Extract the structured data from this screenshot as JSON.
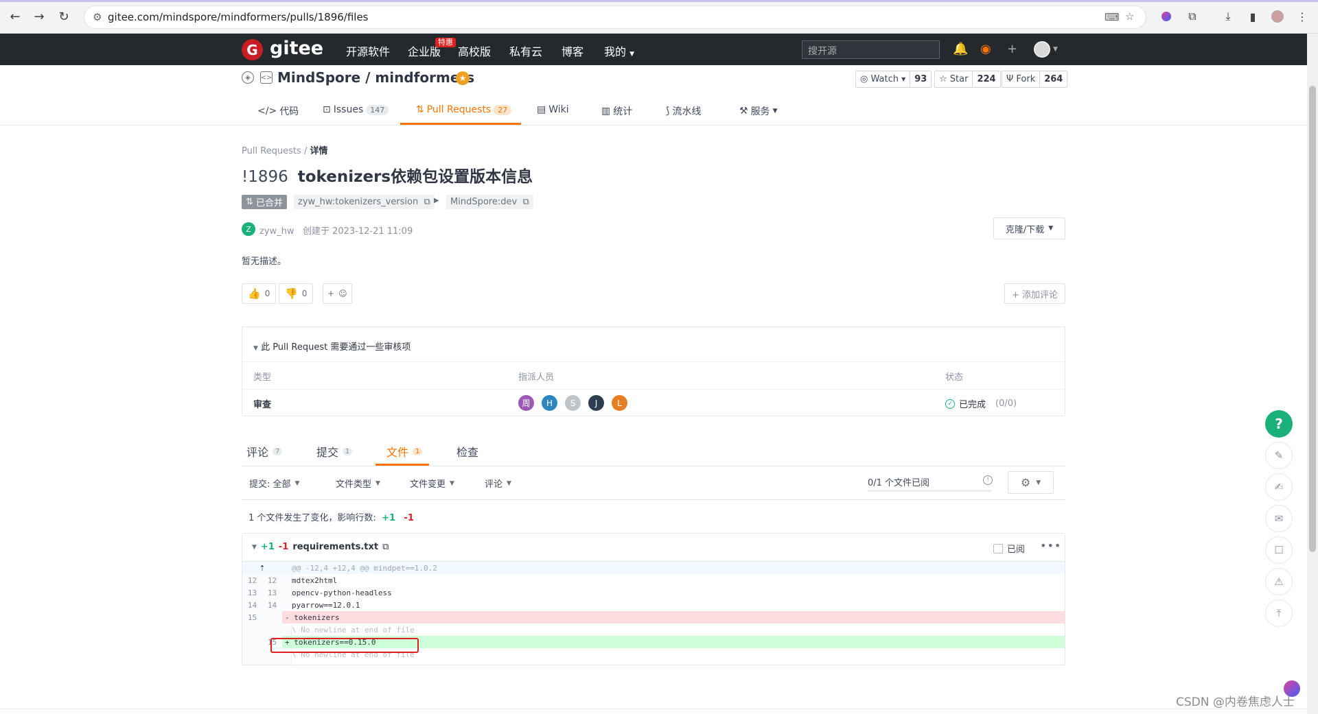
{
  "browser": {
    "url": "gitee.com/mindspore/mindformers/pulls/1896/files"
  },
  "gitee": {
    "logo": "gitee",
    "nav": [
      "开源软件",
      "企业版",
      "高校版",
      "私有云",
      "博客",
      "我的"
    ],
    "special_badge": "特惠",
    "search_placeholder": "搜开源"
  },
  "repo": {
    "title": "MindSpore / mindformers",
    "watch_label": "Watch",
    "watch_count": "93",
    "star_label": "Star",
    "star_count": "224",
    "fork_label": "Fork",
    "fork_count": "264",
    "tabs": [
      {
        "label": "代码",
        "icon": "code-icon"
      },
      {
        "label": "Issues",
        "count": "147"
      },
      {
        "label": "Pull Requests",
        "count": "27"
      },
      {
        "label": "Wiki"
      },
      {
        "label": "统计"
      },
      {
        "label": "流水线"
      },
      {
        "label": "服务"
      }
    ]
  },
  "pr": {
    "breadcrumb_root": "Pull Requests",
    "breadcrumb_sep": "/",
    "breadcrumb_current": "详情",
    "number": "!1896",
    "title": "tokenizers依赖包设置版本信息",
    "status": "已合并",
    "source_branch": "zyw_hw:tokenizers_version",
    "target_branch": "MindSpore:dev",
    "author_initial": "Z",
    "author": "zyw_hw",
    "created": "创建于 2023-12-21 11:09",
    "clone_label": "克隆/下载",
    "description": "暂无描述。",
    "thumbs_up": "0",
    "thumbs_down": "0",
    "add_emoji": "+",
    "add_comment": "+ 添加评论"
  },
  "review": {
    "title": "此 Pull Request 需要通过一些审核项",
    "col_type": "类型",
    "col_assignees": "指派人员",
    "col_status": "状态",
    "row_type": "审查",
    "assignees": [
      {
        "initial": "周",
        "color": "#9b59b6"
      },
      {
        "initial": "H",
        "color": "#2e86c1"
      },
      {
        "initial": "S",
        "color": "#bfc4c9"
      },
      {
        "initial": "J",
        "color": "#2c3e50"
      },
      {
        "initial": "L",
        "color": "#e67e22"
      }
    ],
    "status": "已完成",
    "status_frac": "(0/0)"
  },
  "pr_tabs": [
    {
      "label": "评论",
      "count": "7"
    },
    {
      "label": "提交",
      "count": "1"
    },
    {
      "label": "文件",
      "count": "1"
    },
    {
      "label": "检查"
    }
  ],
  "filters": {
    "commit": "提交: 全部",
    "filetype": "文件类型",
    "filechange": "文件变更",
    "comment": "评论",
    "viewed": "0/1 个文件已阅"
  },
  "summary": {
    "text": "1 个文件发生了变化，影响行数:",
    "add": "+1",
    "del": "-1"
  },
  "diff": {
    "add": "+1",
    "del": "-1",
    "filename": "requirements.txt",
    "viewed_label": "已阅",
    "hunk": "@@ -12,4 +12,4 @@ mindpet==1.0.2",
    "lines": [
      {
        "old": "12",
        "new": "12",
        "code": "mdtex2html",
        "kind": "ctx"
      },
      {
        "old": "13",
        "new": "13",
        "code": "opencv-python-headless",
        "kind": "ctx"
      },
      {
        "old": "14",
        "new": "14",
        "code": "pyarrow==12.0.1",
        "kind": "ctx"
      },
      {
        "old": "15",
        "new": "",
        "code": "- tokenizers",
        "kind": "del"
      },
      {
        "old": "",
        "new": "",
        "code": "\\ No newline at end of file",
        "kind": "note"
      },
      {
        "old": "",
        "new": "15",
        "code": "+ tokenizers==0.15.0",
        "kind": "add"
      },
      {
        "old": "",
        "new": "",
        "code": "\\ No newline at end of file",
        "kind": "note"
      }
    ]
  },
  "help": "?",
  "watermark": "CSDN @内卷焦虑人士"
}
